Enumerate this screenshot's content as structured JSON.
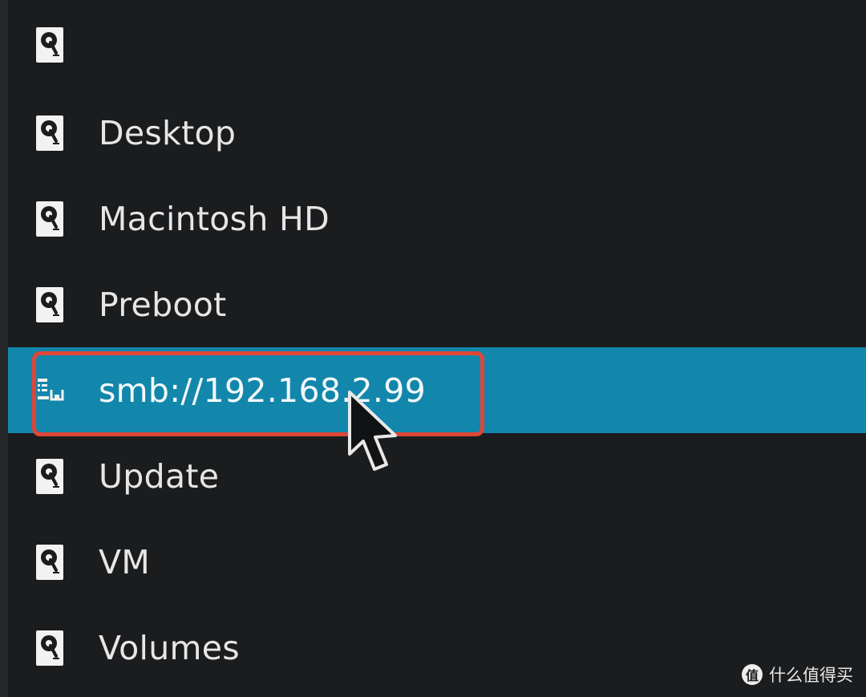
{
  "sidebar": {
    "items": [
      {
        "label": "",
        "icon": "hard-drive-icon",
        "selected": false
      },
      {
        "label": "Desktop",
        "icon": "hard-drive-icon",
        "selected": false
      },
      {
        "label": "Macintosh HD",
        "icon": "hard-drive-icon",
        "selected": false
      },
      {
        "label": "Preboot",
        "icon": "hard-drive-icon",
        "selected": false
      },
      {
        "label": "smb://192.168.2.99",
        "icon": "network-drive-icon",
        "selected": true
      },
      {
        "label": "Update",
        "icon": "hard-drive-icon",
        "selected": false
      },
      {
        "label": "VM",
        "icon": "hard-drive-icon",
        "selected": false
      },
      {
        "label": "Volumes",
        "icon": "hard-drive-icon",
        "selected": false
      }
    ]
  },
  "watermark": {
    "badge": "值",
    "text": "什么值得买"
  },
  "colors": {
    "background": "#1b1c1e",
    "selection": "#1287ab",
    "text": "#e6e6e6",
    "highlight_outline": "#df4638"
  }
}
